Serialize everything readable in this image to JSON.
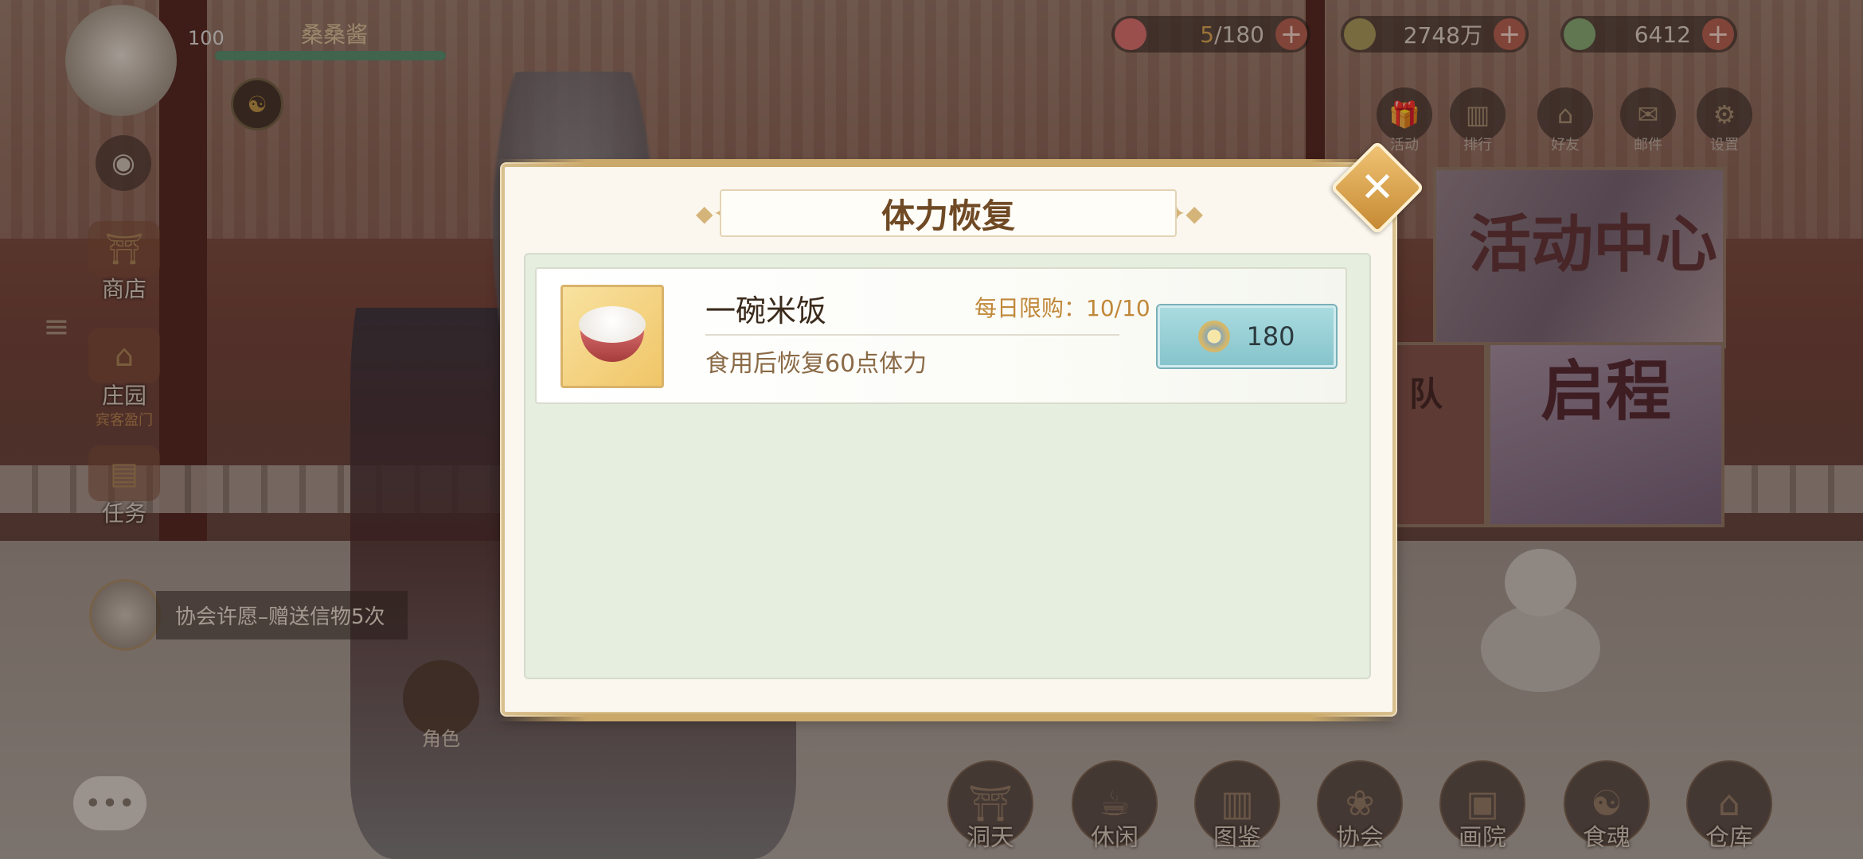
{
  "player": {
    "level": "100",
    "name": "桑桑酱"
  },
  "resources": [
    {
      "icon": "stamina-icon",
      "value_current": "5",
      "value_max": "/180",
      "color": "#d86b6b"
    },
    {
      "icon": "copper-coin-icon",
      "value": "2748万",
      "color": "#a39656"
    },
    {
      "icon": "jade-coin-icon",
      "value": "6412",
      "color": "#7fa870"
    }
  ],
  "top_buttons": [
    {
      "icon": "gift-icon",
      "label": "活动"
    },
    {
      "icon": "ranking-icon",
      "label": "排行"
    },
    {
      "icon": "friends-icon",
      "label": "好友"
    },
    {
      "icon": "mail-icon",
      "label": "邮件"
    },
    {
      "icon": "gear-icon",
      "label": "设置"
    }
  ],
  "left_menu": {
    "shop": "商店",
    "manor": "庄园",
    "manor_sub": "宾客盈门",
    "tasks": "任务"
  },
  "quest_tip": "协会许愿–赠送信物5次",
  "role_label": "角色",
  "banners": {
    "activity_center": "活动中心",
    "departure": "启程",
    "team": "队"
  },
  "bottom_nav": [
    {
      "icon": "cave-icon",
      "label": "洞天"
    },
    {
      "icon": "leisure-icon",
      "label": "休闲"
    },
    {
      "icon": "catalog-icon",
      "label": "图鉴"
    },
    {
      "icon": "association-icon",
      "label": "协会"
    },
    {
      "icon": "painting-icon",
      "label": "画院"
    },
    {
      "icon": "food-soul-icon",
      "label": "食魂"
    },
    {
      "icon": "warehouse-icon",
      "label": "仓库"
    }
  ],
  "dialog": {
    "title": "体力恢复",
    "item": {
      "name": "一碗米饭",
      "limit_label": "每日限购：",
      "limit_value": "10/10",
      "description": "食用后恢复60点体力",
      "price": "180"
    }
  },
  "colors": {
    "dialog_bg": "#fbf7ee",
    "title_text": "#6f4a25",
    "buy_button": "#a9dbe0",
    "accent_gold": "#c58932"
  }
}
